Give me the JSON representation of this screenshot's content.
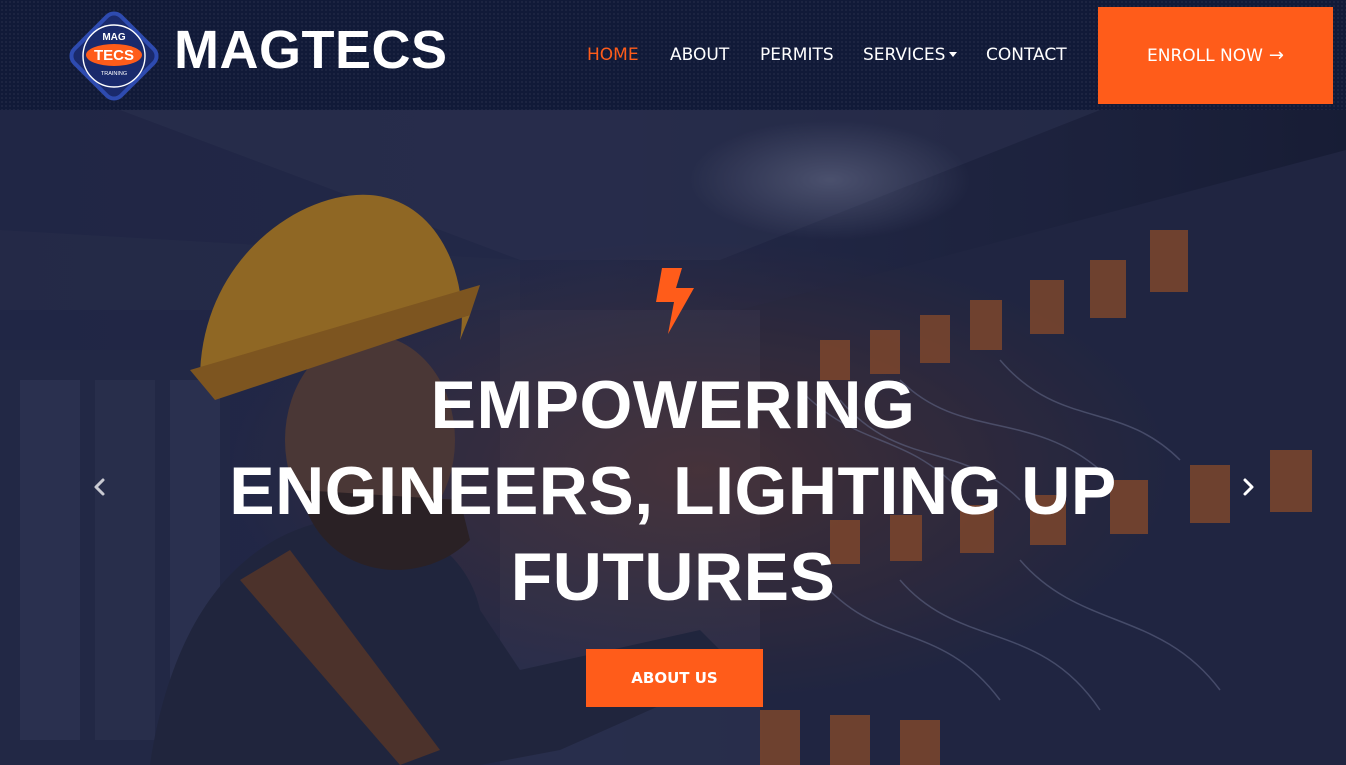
{
  "brand": {
    "name": "MAGTECS",
    "logo_text_top": "MAG",
    "logo_text_main": "TECS",
    "logo_text_bottom": "TRAINING"
  },
  "nav": {
    "items": [
      {
        "label": "HOME",
        "active": true
      },
      {
        "label": "ABOUT"
      },
      {
        "label": "PERMITS"
      },
      {
        "label": "SERVICES",
        "has_dropdown": true
      },
      {
        "label": "CONTACT"
      }
    ],
    "enroll_label": "ENROLL NOW",
    "enroll_icon": "arrow-right-icon"
  },
  "hero": {
    "icon": "lightning-bolt-icon",
    "headline_lines": [
      "EMPOWERING",
      "ENGINEERS, LIGHTING UP",
      "FUTURES"
    ],
    "cta_label": "ABOUT US",
    "prev_icon": "chevron-left-icon",
    "next_icon": "chevron-right-icon"
  },
  "colors": {
    "accent": "#ff5c1a",
    "header_bg": "#111a38",
    "text": "#ffffff"
  }
}
